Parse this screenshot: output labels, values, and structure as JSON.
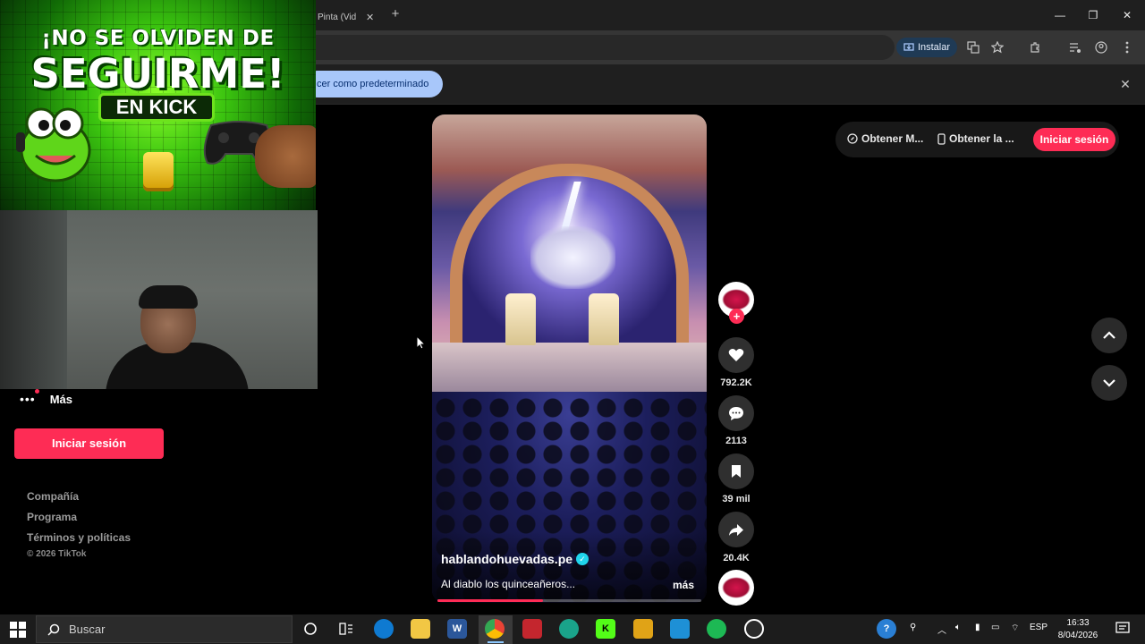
{
  "browser": {
    "tab_title": "Pinta (Vid",
    "tab_close": "✕",
    "new_tab": "+",
    "install_label": "Instalar",
    "infobar_text": "cer como predeterminado",
    "infobar_close": "✕",
    "window_controls": {
      "minimize": "—",
      "maximize": "❐",
      "close": "✕"
    }
  },
  "stream_overlay": {
    "line1": "¡NO SE OLVIDEN DE",
    "line2": "SEGUIRME!",
    "pill": "EN KICK"
  },
  "sidebar": {
    "more_label": "Más",
    "login_label": "Iniciar sesión",
    "footer_links": [
      "Compañía",
      "Programa",
      "Términos y políticas"
    ],
    "copyright": "© 2026 TikTok"
  },
  "video": {
    "author": "hablandohuevadas.pe",
    "verified_mark": "✓",
    "description": "Al diablo los quinceañeros...",
    "more_label": "más",
    "progress": 0.4
  },
  "actions": {
    "follow_plus": "+",
    "likes": "792.2K",
    "comments": "2113",
    "saves": "39 mil",
    "shares": "20.4K"
  },
  "top_actions": {
    "get_coins": "Obtener M...",
    "get_app": "Obtener la ...",
    "login": "Iniciar sesión"
  },
  "taskbar": {
    "search_placeholder": "Buscar",
    "language": "ESP",
    "time": "16:33",
    "date": "8/04/2026"
  },
  "colors": {
    "tiktok_red": "#fe2c55",
    "kick_green": "#53fc18",
    "verified_blue": "#20d5ec"
  }
}
